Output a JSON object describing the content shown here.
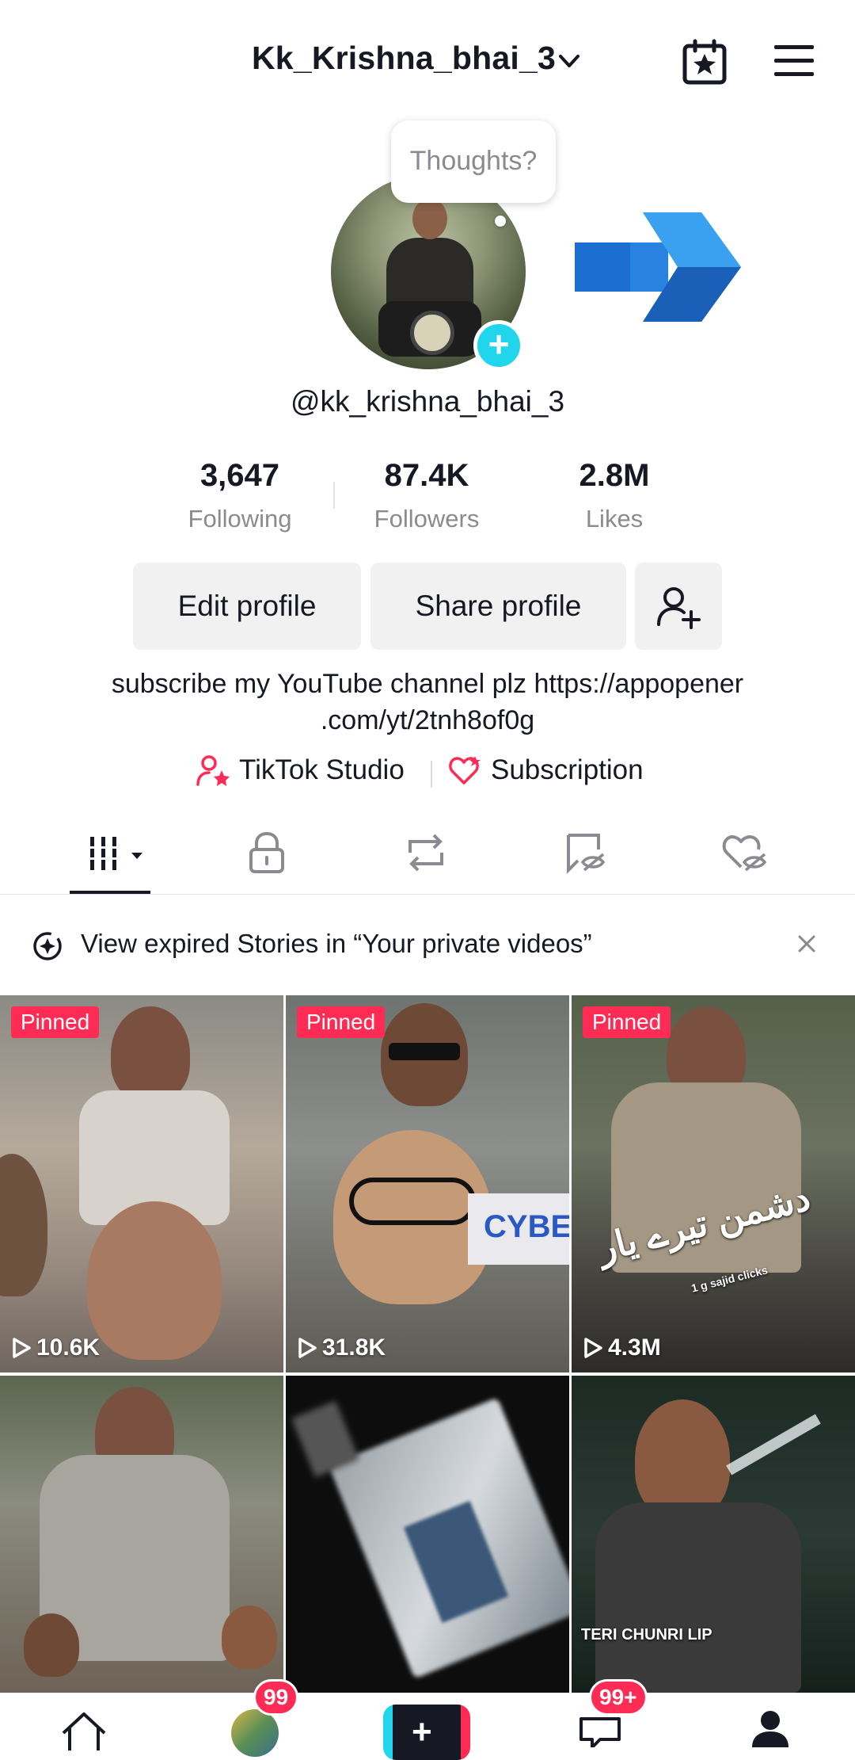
{
  "header": {
    "username": "Kk_Krishna_bhai_3",
    "calendar_icon": "calendar-star-icon",
    "menu_icon": "hamburger-menu-icon"
  },
  "profile": {
    "bubble_text": "Thoughts?",
    "handle": "@kk_krishna_bhai_3",
    "bio": "subscribe my YouTube channel plz https://appopener .com/yt/2tnh8of0g"
  },
  "stats": [
    {
      "value": "3,647",
      "label": "Following"
    },
    {
      "value": "87.4K",
      "label": "Followers"
    },
    {
      "value": "2.8M",
      "label": "Likes"
    }
  ],
  "buttons": {
    "edit": "Edit profile",
    "share": "Share profile"
  },
  "links": {
    "studio": "TikTok Studio",
    "subscription": "Subscription"
  },
  "tabs": [
    "videos-grid-icon",
    "lock-icon",
    "repost-icon",
    "bookmark-icon",
    "liked-heart-icon"
  ],
  "notice": {
    "text": "View expired Stories in “Your private videos”"
  },
  "grid": {
    "items": [
      {
        "pinned": "Pinned",
        "views": "10.6K"
      },
      {
        "pinned": "Pinned",
        "views": "31.8K",
        "caption": "CYBE"
      },
      {
        "pinned": "Pinned",
        "views": "4.3M",
        "caption": "دشمن تیرے یار",
        "caption2": "1 g sajid clicks"
      },
      {
        "caption": ""
      },
      {
        "caption": ""
      },
      {
        "caption": "TERI CHUNRI LIP"
      }
    ]
  },
  "nav": {
    "friends_badge": "99",
    "inbox_badge": "99+"
  },
  "colors": {
    "accent": "#fe2c55",
    "cyan": "#20d5ec",
    "text": "#161823",
    "muted": "#8a8b91"
  }
}
